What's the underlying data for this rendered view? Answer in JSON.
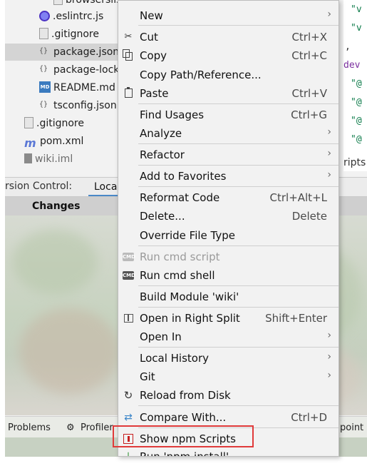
{
  "tree": {
    "items": [
      {
        "label": "browserslistrc",
        "icon": "file-icon"
      },
      {
        "label": ".eslintrc.js",
        "icon": "eslint-icon"
      },
      {
        "label": ".gitignore",
        "icon": "file-icon"
      },
      {
        "label": "package.json",
        "icon": "json-icon",
        "selected": true
      },
      {
        "label": "package-lock",
        "icon": "json-icon"
      },
      {
        "label": "README.md",
        "icon": "markdown-icon"
      },
      {
        "label": "tsconfig.json",
        "icon": "json-icon"
      },
      {
        "label": ".gitignore",
        "icon": "file-icon"
      },
      {
        "label": "pom.xml",
        "icon": "maven-icon"
      },
      {
        "label": "wiki.iml",
        "icon": "iml-icon"
      }
    ]
  },
  "code": {
    "lines": [
      "\"v",
      "\"v",
      ",",
      "dev",
      "\"@",
      "\"@",
      "\"@",
      "\"@",
      "ripts"
    ]
  },
  "vcs": {
    "title": "rsion Control:",
    "tab": "Local",
    "changes": "Changes"
  },
  "status": {
    "problems": "Problems",
    "profiler": "Profiler",
    "point": "point"
  },
  "menu": {
    "new": {
      "label": "New"
    },
    "cut": {
      "label": "Cut",
      "shortcut": "Ctrl+X"
    },
    "copy": {
      "label": "Copy",
      "shortcut": "Ctrl+C"
    },
    "copy_path": {
      "label": "Copy Path/Reference..."
    },
    "paste": {
      "label": "Paste",
      "shortcut": "Ctrl+V"
    },
    "find_usages": {
      "label": "Find Usages",
      "shortcut": "Ctrl+G"
    },
    "analyze": {
      "label": "Analyze"
    },
    "refactor": {
      "label": "Refactor"
    },
    "add_favorites": {
      "label": "Add to Favorites"
    },
    "reformat": {
      "label": "Reformat Code",
      "shortcut": "Ctrl+Alt+L"
    },
    "delete": {
      "label": "Delete...",
      "shortcut": "Delete"
    },
    "override": {
      "label": "Override File Type"
    },
    "run_cmd_script": {
      "label": "Run cmd script"
    },
    "run_cmd_shell": {
      "label": "Run cmd shell"
    },
    "build_module": {
      "label": "Build Module 'wiki'"
    },
    "open_right": {
      "label": "Open in Right Split",
      "shortcut": "Shift+Enter"
    },
    "open_in": {
      "label": "Open In"
    },
    "local_history": {
      "label": "Local History"
    },
    "git": {
      "label": "Git"
    },
    "reload": {
      "label": "Reload from Disk"
    },
    "compare": {
      "label": "Compare With...",
      "shortcut": "Ctrl+D"
    },
    "show_npm": {
      "label": "Show npm Scripts"
    },
    "run_npm": {
      "label": "Run 'npm install'"
    }
  },
  "colors": {
    "highlight": "#e03a3a",
    "menu_bg": "#f2f2f2"
  }
}
